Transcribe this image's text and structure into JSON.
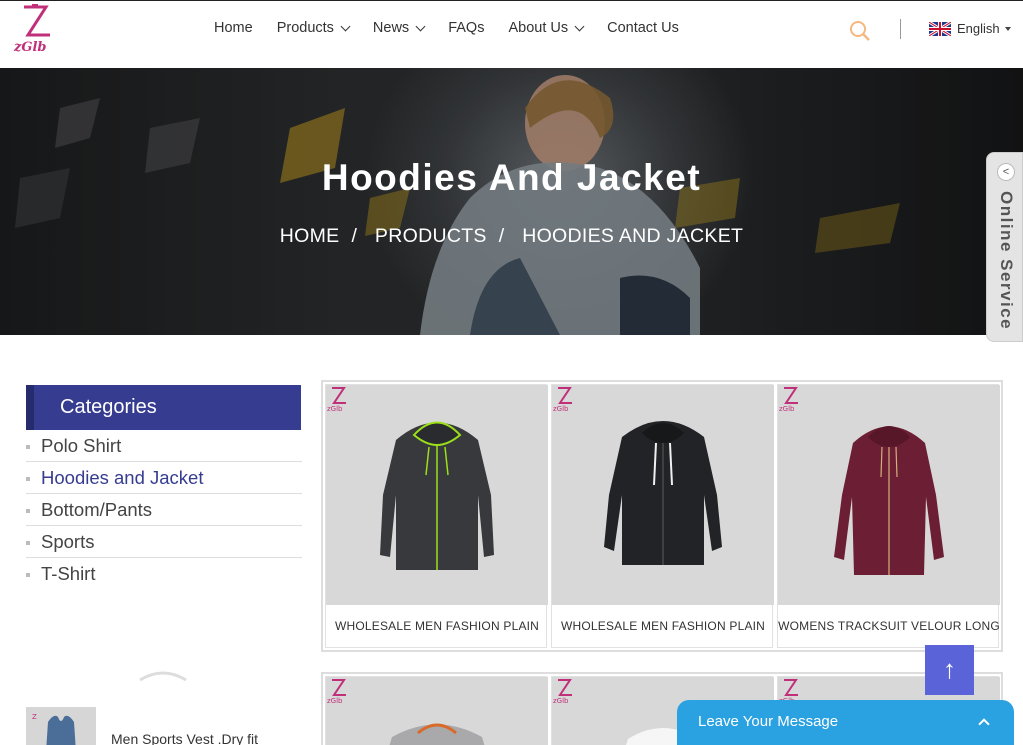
{
  "header": {
    "logo_text": "zGlb",
    "nav": [
      {
        "label": "Home",
        "has_dropdown": false
      },
      {
        "label": "Products",
        "has_dropdown": true
      },
      {
        "label": "News",
        "has_dropdown": true
      },
      {
        "label": "FAQs",
        "has_dropdown": false
      },
      {
        "label": "About Us",
        "has_dropdown": true
      },
      {
        "label": "Contact Us",
        "has_dropdown": false
      }
    ],
    "search_icon": "search-icon",
    "language": "English"
  },
  "banner": {
    "title": "Hoodies And Jacket",
    "breadcrumb": [
      "HOME",
      "PRODUCTS",
      "HOODIES AND JACKET"
    ],
    "separator": "/"
  },
  "online_service": {
    "label": "Online Service",
    "arrow": "<"
  },
  "sidebar": {
    "heading": "Categories",
    "items": [
      {
        "label": "Polo Shirt",
        "active": false
      },
      {
        "label": "Hoodies and Jacket",
        "active": true
      },
      {
        "label": "Bottom/Pants",
        "active": false
      },
      {
        "label": "Sports",
        "active": false
      },
      {
        "label": "T-Shirt",
        "active": false
      }
    ],
    "featured": {
      "title": "Men Sports Vest .Dry fit"
    }
  },
  "products": [
    {
      "title": "WHOLESALE MEN FASHION PLAIN",
      "garment": "dark-hoodie-green-trim"
    },
    {
      "title": "WHOLESALE MEN FASHION PLAIN",
      "garment": "black-hoodie-white-cords"
    },
    {
      "title": "WOMENS TRACKSUIT VELOUR LONG",
      "garment": "burgundy-velour-hoodie"
    }
  ],
  "floating": {
    "to_top": "↑",
    "leave_message": "Leave Your Message"
  },
  "colors": {
    "brand": "#363c90",
    "logo": "#c0307a",
    "to_top": "#5a64d8",
    "chat": "#2aa1e0",
    "search": "#f5b880"
  }
}
